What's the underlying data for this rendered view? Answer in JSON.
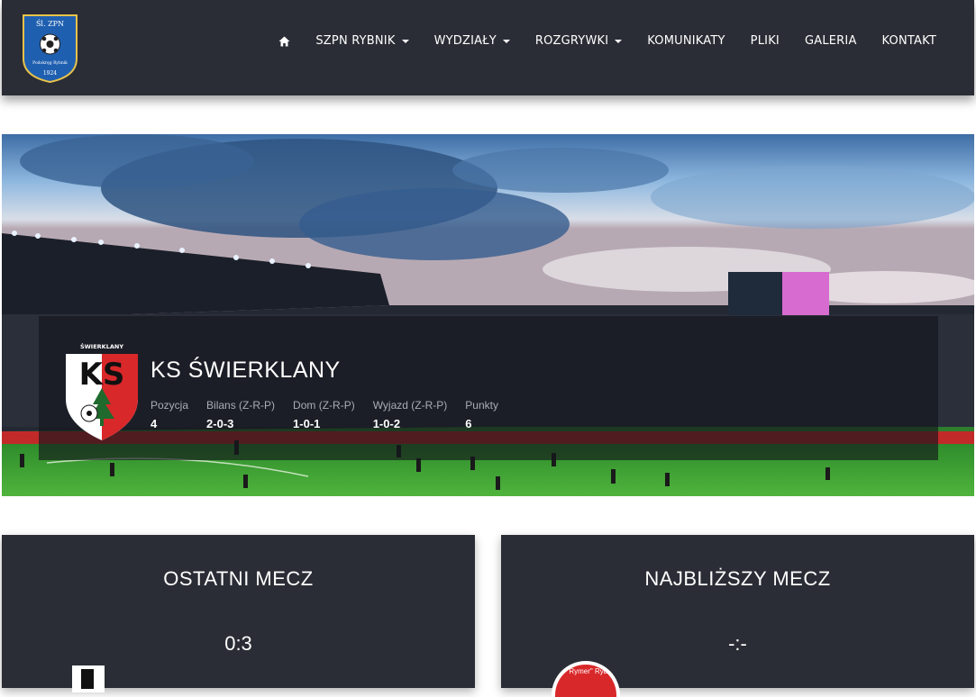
{
  "header": {
    "logo": {
      "top_text": "Śl. ZPN",
      "middle_text": "Podokręg Rybnik",
      "year": "1924"
    },
    "nav": [
      {
        "label": "",
        "icon": "home-icon",
        "dropdown": false
      },
      {
        "label": "SZPN RYBNIK",
        "dropdown": true
      },
      {
        "label": "WYDZIAŁY",
        "dropdown": true
      },
      {
        "label": "ROZGRYWKI",
        "dropdown": true
      },
      {
        "label": "KOMUNIKATY",
        "dropdown": false
      },
      {
        "label": "PLIKI",
        "dropdown": false
      },
      {
        "label": "GALERIA",
        "dropdown": false
      },
      {
        "label": "KONTAKT",
        "dropdown": false
      }
    ]
  },
  "club": {
    "badge_text": "ŚWIERKLANY",
    "badge_letters": "KS",
    "name": "KS ŚWIERKLANY",
    "stats": [
      {
        "label": "Pozycja",
        "value": "4"
      },
      {
        "label": "Bilans (Z-R-P)",
        "value": "2-0-3"
      },
      {
        "label": "Dom (Z-R-P)",
        "value": "1-0-1"
      },
      {
        "label": "Wyjazd (Z-R-P)",
        "value": "1-0-2"
      },
      {
        "label": "Punkty",
        "value": "6"
      }
    ]
  },
  "last_match": {
    "title": "OSTATNI MECZ",
    "score": "0:3"
  },
  "next_match": {
    "title": "NAJBLIŻSZY MECZ",
    "score": "-:-",
    "opponent_logo_text": "KS \"Rymer\" Rybnik"
  },
  "colors": {
    "navbar": "#2a2d35",
    "accent_red": "#d9282a",
    "logo_blue": "#1f5fb0"
  }
}
